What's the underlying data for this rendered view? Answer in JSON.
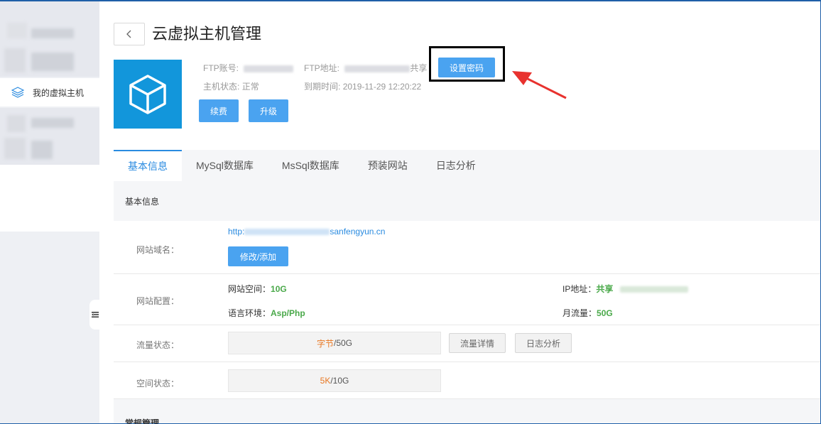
{
  "sidebar": {
    "active_item": "我的虚拟主机"
  },
  "header": {
    "title": "云虚拟主机管理"
  },
  "host_info": {
    "ftp_account_label": "FTP账号:",
    "ftp_address_label": "FTP地址:",
    "ftp_address_suffix": "共享",
    "status_label": "主机状态:",
    "status_value": "正常",
    "expire_label": "到期时间:",
    "expire_value": "2019-11-29 12:20:22",
    "set_password": "设置密码",
    "renew": "续费",
    "upgrade": "升级"
  },
  "tabs": [
    {
      "label": "基本信息",
      "active": true
    },
    {
      "label": "MySql数据库",
      "active": false
    },
    {
      "label": "MsSql数据库",
      "active": false
    },
    {
      "label": "预装网站",
      "active": false
    },
    {
      "label": "日志分析",
      "active": false
    }
  ],
  "basic_info": {
    "section_title": "基本信息",
    "domain_label": "网站域名：",
    "domain_prefix": "http:",
    "domain_suffix": "sanfengyun.cn",
    "domain_button": "修改/添加",
    "config_label": "网站配置：",
    "space_key": "网站空间：",
    "space_value": "10G",
    "ip_key": "IP地址：",
    "ip_value": "共享",
    "lang_key": "语言环境：",
    "lang_value": "Asp/Php",
    "traffic_key": "月流量：",
    "traffic_value": "50G",
    "traffic_status_label": "流量状态：",
    "traffic_used": "字节",
    "traffic_total": "/50G",
    "traffic_detail_button": "流量详情",
    "log_button": "日志分析",
    "space_status_label": "空间状态：",
    "space_used": "5K",
    "space_total": "/10G"
  },
  "next_section": {
    "title": "常规管理"
  },
  "colors": {
    "accent": "#2a8be0",
    "button": "#4aa3f0",
    "icon_bg": "#1296db",
    "value_green": "#4aa94a",
    "usage_orange": "#e87722",
    "annotation_red": "#e8322e"
  }
}
